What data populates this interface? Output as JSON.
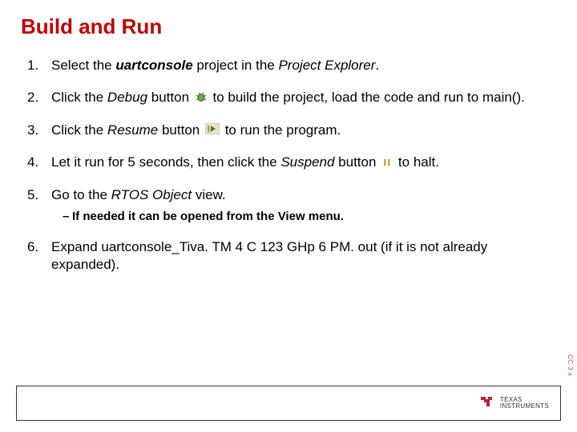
{
  "title": "Build and Run",
  "steps": [
    {
      "num": "1.",
      "pre": "Select the ",
      "bold": "uartconsole",
      "mid": " project in the ",
      "ital": "Project Explorer",
      "post": "."
    },
    {
      "num": "2.",
      "pre": "Click the ",
      "ital": "Debug",
      "mid": " button",
      "icon": "debug",
      "post": " to build the project, load the code and run to main()."
    },
    {
      "num": "3.",
      "pre": "Click the ",
      "ital": "Resume",
      "mid": " button ",
      "icon": "resume",
      "post": "to run the program."
    },
    {
      "num": "4.",
      "pre": "Let it run for 5 seconds, then click the ",
      "ital": "Suspend",
      "mid": " button",
      "icon": "suspend",
      "post": " to halt."
    },
    {
      "num": "5.",
      "pre": "Go to the ",
      "ital": "RTOS Object",
      "post": " view.",
      "sub": "If needed it can be opened from the View menu."
    },
    {
      "num": "6.",
      "pre": "Expand uartconsole_Tiva. TM 4 C 123 GHp 6 PM. out (if it is not already expanded)."
    }
  ],
  "footer": {
    "brand_top": "TEXAS",
    "brand_bottom": "INSTRUMENTS"
  },
  "side": "CC 3 x"
}
